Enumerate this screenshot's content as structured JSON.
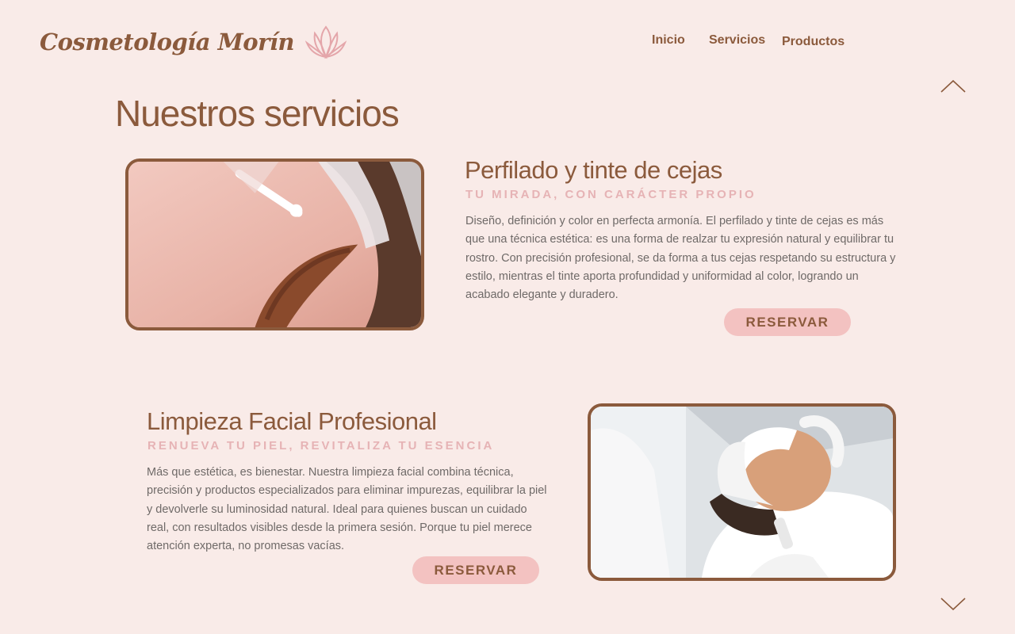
{
  "brand": {
    "name": "Cosmetología Morín",
    "logo_icon": "lotus-icon"
  },
  "nav": {
    "inicio": "Inicio",
    "servicios": "Servicios",
    "productos": "Productos"
  },
  "scroll": {
    "up_icon": "chevron-up-icon",
    "down_icon": "chevron-down-icon"
  },
  "page": {
    "title": "Nuestros servicios"
  },
  "services": [
    {
      "title": "Perfilado y tinte de cejas",
      "subtitle": "TU MIRADA, CON CARÁCTER PROPIO",
      "description": "Diseño, definición y color en perfecta armonía. El perfilado y tinte de cejas es más que una técnica estética: es una forma de realzar tu expresión natural y equilibrar tu rostro. Con precisión profesional, se da forma a tus cejas respetando su estructura y estilo, mientras el tinte aporta profundidad y uniformidad al color, logrando un acabado elegante y duradero.",
      "button": "RESERVAR"
    },
    {
      "title": "Limpieza Facial Profesional",
      "subtitle": "RENUEVA TU PIEL, REVITALIZA TU ESENCIA",
      "description": "Más que estética, es bienestar. Nuestra limpieza facial combina técnica, precisión y productos especializados para eliminar impurezas, equilibrar la piel y devolverle su luminosidad natural. Ideal para quienes buscan un cuidado real, con resultados visibles desde la primera sesión. Porque tu piel merece atención experta, no promesas vacías.",
      "button": "RESERVAR"
    }
  ],
  "colors": {
    "background": "#f9ebe8",
    "brand": "#8b5a3c",
    "accent": "#e6b3b5",
    "button": "#f3c2c1",
    "text": "#6f6a68"
  }
}
